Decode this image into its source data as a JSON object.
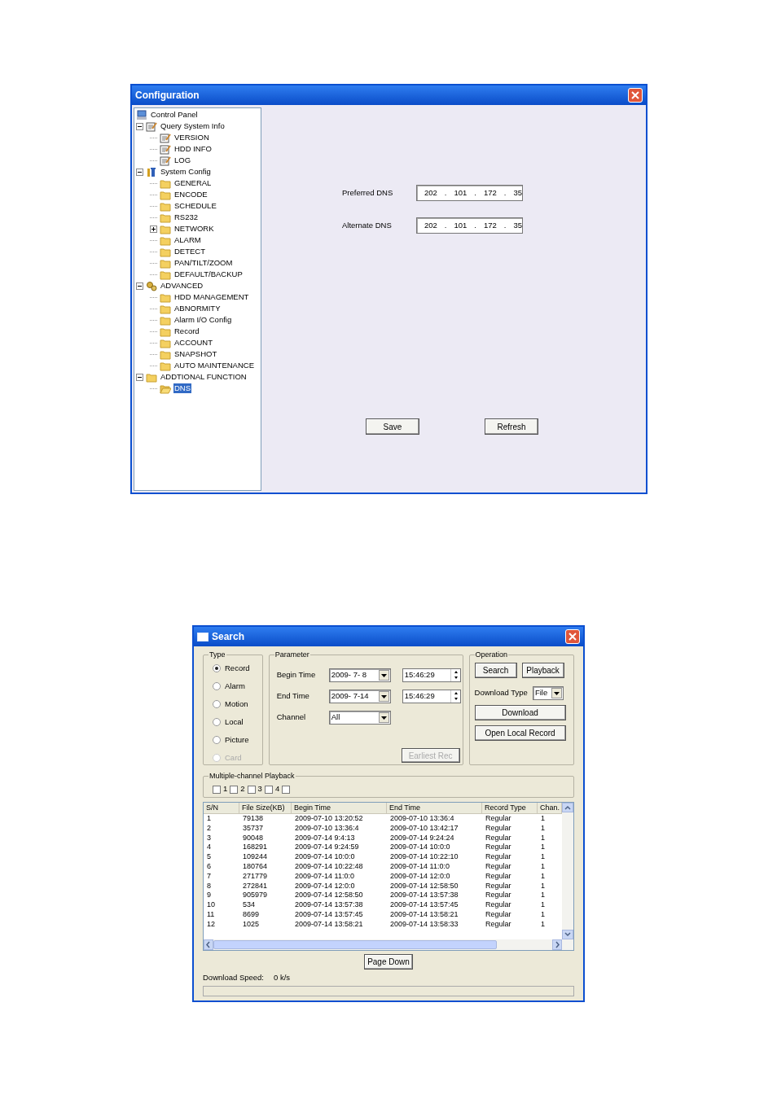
{
  "config_window": {
    "title": "Configuration",
    "tree": [
      {
        "label": "Control Panel",
        "kind": "computer",
        "selected": false
      },
      {
        "label": "Query System Info",
        "kind": "notepad",
        "expanded": true,
        "selected": false,
        "children": [
          {
            "label": "VERSION",
            "kind": "notepad",
            "selected": false
          },
          {
            "label": "HDD INFO",
            "kind": "notepad",
            "selected": false
          },
          {
            "label": "LOG",
            "kind": "notepad",
            "selected": false
          }
        ]
      },
      {
        "label": "System Config",
        "kind": "tools",
        "expanded": true,
        "selected": false,
        "children": [
          {
            "label": "GENERAL",
            "kind": "folder",
            "selected": false
          },
          {
            "label": "ENCODE",
            "kind": "folder",
            "selected": false
          },
          {
            "label": "SCHEDULE",
            "kind": "folder",
            "selected": false
          },
          {
            "label": "RS232",
            "kind": "folder",
            "selected": false
          },
          {
            "label": "NETWORK",
            "kind": "folder",
            "expanded": false,
            "selected": false
          },
          {
            "label": "ALARM",
            "kind": "folder",
            "selected": false
          },
          {
            "label": "DETECT",
            "kind": "folder",
            "selected": false
          },
          {
            "label": "PAN/TILT/ZOOM",
            "kind": "folder",
            "selected": false
          },
          {
            "label": "DEFAULT/BACKUP",
            "kind": "folder",
            "selected": false
          }
        ]
      },
      {
        "label": "ADVANCED",
        "kind": "gears",
        "expanded": true,
        "selected": false,
        "children": [
          {
            "label": "HDD MANAGEMENT",
            "kind": "folder",
            "selected": false
          },
          {
            "label": "ABNORMITY",
            "kind": "folder",
            "selected": false
          },
          {
            "label": "Alarm I/O Config",
            "kind": "folder",
            "selected": false
          },
          {
            "label": "Record",
            "kind": "folder",
            "selected": false
          },
          {
            "label": "ACCOUNT",
            "kind": "folder",
            "selected": false
          },
          {
            "label": "SNAPSHOT",
            "kind": "folder",
            "selected": false
          },
          {
            "label": "AUTO MAINTENANCE",
            "kind": "folder",
            "selected": false
          }
        ]
      },
      {
        "label": "ADDTIONAL FUNCTION",
        "kind": "folder",
        "expanded": true,
        "selected": false,
        "children": [
          {
            "label": "DNS",
            "kind": "folder",
            "selected": true
          }
        ]
      }
    ],
    "dns": [
      {
        "label": "Preferred DNS",
        "octets": [
          "202",
          "101",
          "172",
          "35"
        ]
      },
      {
        "label": "Alternate DNS",
        "octets": [
          "202",
          "101",
          "172",
          "35"
        ]
      }
    ],
    "separator": ".",
    "buttons": [
      "Save",
      "Refresh"
    ]
  },
  "search_window": {
    "title": "Search",
    "type_group": {
      "title": "Type",
      "options": [
        {
          "label": "Record",
          "selected": true,
          "disabled": false
        },
        {
          "label": "Alarm",
          "selected": false,
          "disabled": false
        },
        {
          "label": "Motion",
          "selected": false,
          "disabled": false
        },
        {
          "label": "Local",
          "selected": false,
          "disabled": false
        },
        {
          "label": "Picture",
          "selected": false,
          "disabled": false
        },
        {
          "label": "Card",
          "selected": false,
          "disabled": true
        }
      ]
    },
    "parameter_group": {
      "title": "Parameter",
      "fields": [
        {
          "kind": "datetime",
          "label": "Begin Time",
          "date": "2009- 7- 8",
          "time": "15:46:29"
        },
        {
          "kind": "datetime",
          "label": "End Time",
          "date": "2009- 7-14",
          "time": "15:46:29"
        },
        {
          "kind": "select",
          "label": "Channel",
          "value": "All"
        }
      ],
      "earliest_button": {
        "label": "Earliest Rec",
        "disabled": true
      }
    },
    "operation_group": {
      "title": "Operation",
      "buttons": [
        "Search",
        "Playback"
      ],
      "download_type": {
        "label": "Download Type",
        "value": "File"
      },
      "actions": [
        "Download",
        "Open Local Record"
      ]
    },
    "multichannel": {
      "title": "Multiple-channel Playback",
      "channels": [
        {
          "label": "1",
          "checked": false
        },
        {
          "label": "2",
          "checked": false
        },
        {
          "label": "3",
          "checked": false
        },
        {
          "label": "4",
          "checked": false
        },
        {
          "checked": false
        }
      ]
    },
    "table": {
      "columns": [
        "S/N",
        "File Size(KB)",
        "Begin Time",
        "End Time",
        "Record Type",
        "Chan."
      ],
      "rows": [
        [
          "1",
          "79138",
          "2009-07-10 13:20:52",
          "2009-07-10 13:36:4",
          "Regular",
          "1"
        ],
        [
          "2",
          "35737",
          "2009-07-10 13:36:4",
          "2009-07-10 13:42:17",
          "Regular",
          "1"
        ],
        [
          "3",
          "90048",
          "2009-07-14 9:4:13",
          "2009-07-14 9:24:24",
          "Regular",
          "1"
        ],
        [
          "4",
          "168291",
          "2009-07-14 9:24:59",
          "2009-07-14 10:0:0",
          "Regular",
          "1"
        ],
        [
          "5",
          "109244",
          "2009-07-14 10:0:0",
          "2009-07-14 10:22:10",
          "Regular",
          "1"
        ],
        [
          "6",
          "180764",
          "2009-07-14 10:22:48",
          "2009-07-14 11:0:0",
          "Regular",
          "1"
        ],
        [
          "7",
          "271779",
          "2009-07-14 11:0:0",
          "2009-07-14 12:0:0",
          "Regular",
          "1"
        ],
        [
          "8",
          "272841",
          "2009-07-14 12:0:0",
          "2009-07-14 12:58:50",
          "Regular",
          "1"
        ],
        [
          "9",
          "905979",
          "2009-07-14 12:58:50",
          "2009-07-14 13:57:38",
          "Regular",
          "1"
        ],
        [
          "10",
          "534",
          "2009-07-14 13:57:38",
          "2009-07-14 13:57:45",
          "Regular",
          "1"
        ],
        [
          "11",
          "8699",
          "2009-07-14 13:57:45",
          "2009-07-14 13:58:21",
          "Regular",
          "1"
        ],
        [
          "12",
          "1025",
          "2009-07-14 13:58:21",
          "2009-07-14 13:58:33",
          "Regular",
          "1"
        ]
      ]
    },
    "page_down": "Page Down",
    "download_speed": {
      "label": "Download Speed:",
      "value": "0 k/s"
    },
    "progress": {
      "level": 0
    }
  }
}
